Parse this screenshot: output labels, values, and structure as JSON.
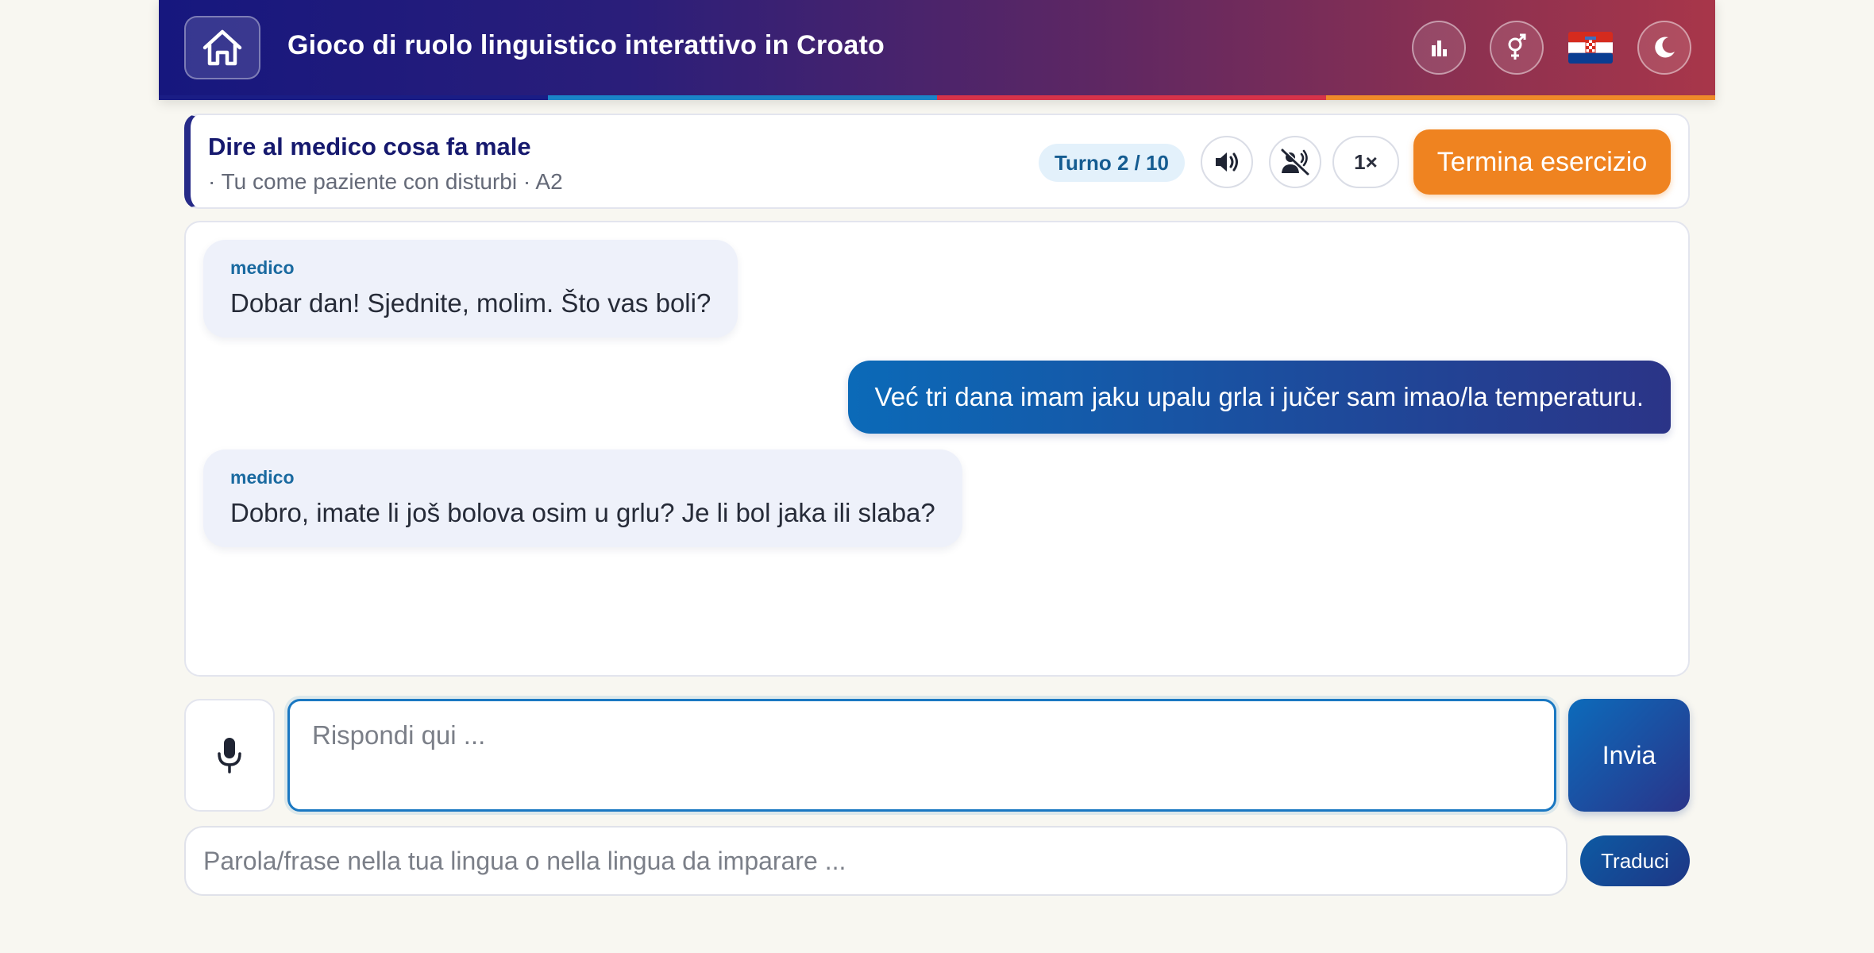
{
  "header": {
    "title": "Gioco di ruolo linguistico interattivo in Croato",
    "stripe_colors": [
      "#1a1d85",
      "#1a84c8",
      "#d6334a",
      "#ef8a2a"
    ],
    "icons": [
      "home-icon",
      "bar-chart-icon",
      "gender-icon",
      "croatia-flag-icon",
      "moon-icon"
    ]
  },
  "exercise": {
    "title": "Dire al medico cosa fa male",
    "subtitle": "· Tu come paziente con disturbi · A2",
    "turn": "Turno 2 / 10",
    "speed": "1×",
    "end_label": "Termina esercizio",
    "accent": "#ef8320"
  },
  "chat": {
    "messages": [
      {
        "role": "bot",
        "speaker": "medico",
        "text": "Dobar dan! Sjednite, molim. Što vas boli?"
      },
      {
        "role": "user",
        "text": "Već tri dana imam jaku upalu grla i jučer sam imao/la temperaturu."
      },
      {
        "role": "bot",
        "speaker": "medico",
        "text": "Dobro, imate li još bolova osim u grlu? Je li bol jaka ili slaba?"
      }
    ]
  },
  "composer": {
    "reply_placeholder": "Rispondi qui ...",
    "send_label": "Invia",
    "translate_placeholder": "Parola/frase nella tua lingua o nella lingua da imparare ...",
    "translate_label": "Traduci"
  }
}
